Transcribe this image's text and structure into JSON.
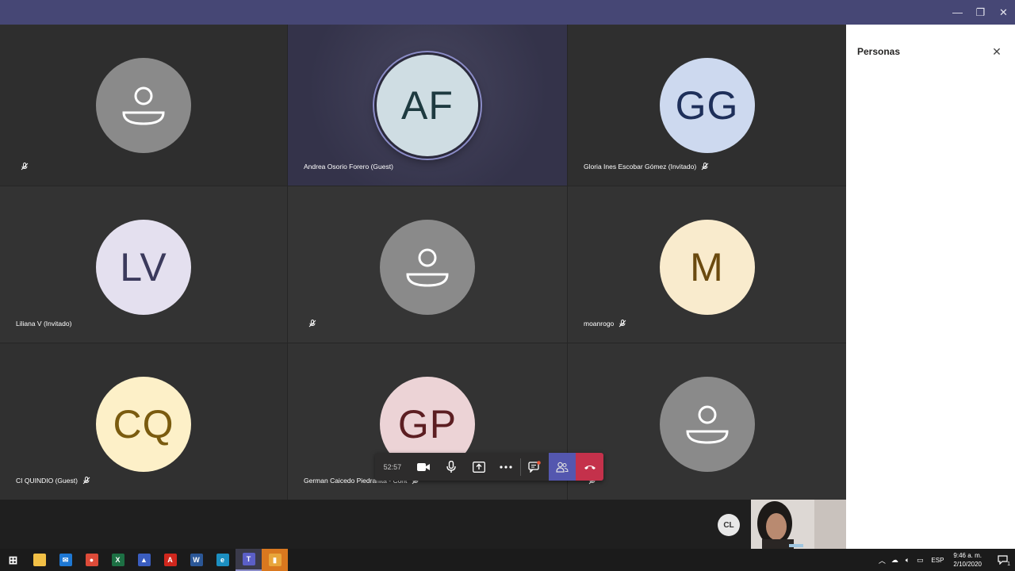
{
  "window": {
    "minimize_label": "—",
    "restore_label": "❐",
    "close_label": "✕"
  },
  "tiles": [
    {
      "kind": "generic",
      "name": "",
      "muted": true
    },
    {
      "kind": "initials",
      "initials": "AF",
      "name": "Andrea Osorio Forero (Guest)",
      "muted": false,
      "speaking": true,
      "bg": "#cfdde3",
      "fg": "#1e3a40"
    },
    {
      "kind": "initials",
      "initials": "GG",
      "name": "Gloria Ines Escobar Gómez (Invitado)",
      "muted": true,
      "bg": "#cdd9ef",
      "fg": "#1e2f5a"
    },
    {
      "kind": "initials",
      "initials": "LV",
      "name": "Liliana V (Invitado)",
      "muted": false,
      "bg": "#e4e0ef",
      "fg": "#3b3a5c"
    },
    {
      "kind": "generic",
      "name": "",
      "muted": true
    },
    {
      "kind": "initials",
      "initials": "M",
      "name": "moanrogo",
      "muted": true,
      "bg": "#f9ebcd",
      "fg": "#6b4a0f"
    },
    {
      "kind": "initials",
      "initials": "CQ",
      "name": "CI QUINDIO (Guest)",
      "muted": true,
      "bg": "#fdf0c8",
      "fg": "#7a5b0f"
    },
    {
      "kind": "initials",
      "initials": "GP",
      "name": "German Caicedo Piedrahita - Cont",
      "muted": true,
      "bg": "#ecd3d6",
      "fg": "#5c1e22"
    },
    {
      "kind": "generic",
      "name": "",
      "muted": true
    }
  ],
  "controls": {
    "timer": "52:57",
    "icons": [
      "video-icon",
      "microphone-icon",
      "share-screen-icon",
      "more-icon",
      "chat-icon",
      "people-icon",
      "hang-up-icon"
    ]
  },
  "panel": {
    "title": "Personas",
    "close_label": "✕"
  },
  "self_view": {
    "initials": "CL"
  },
  "taskbar": {
    "apps": [
      {
        "name": "start",
        "color": "#1b1b1b",
        "glyph": "⊞"
      },
      {
        "name": "file-explorer",
        "color": "#f2c046",
        "glyph": ""
      },
      {
        "name": "mail",
        "color": "#1e78d4",
        "glyph": "✉"
      },
      {
        "name": "chrome",
        "color": "#dd4b39",
        "glyph": "●"
      },
      {
        "name": "excel",
        "color": "#1d7044",
        "glyph": "X"
      },
      {
        "name": "app",
        "color": "#3a5dbf",
        "glyph": "▲"
      },
      {
        "name": "acrobat",
        "color": "#d0271d",
        "glyph": "A"
      },
      {
        "name": "word",
        "color": "#2b5797",
        "glyph": "W"
      },
      {
        "name": "edge",
        "color": "#1c8fc1",
        "glyph": "e"
      },
      {
        "name": "teams",
        "color": "#5b5fc7",
        "glyph": "T"
      },
      {
        "name": "app2",
        "color": "#e8a53a",
        "glyph": "▮"
      }
    ],
    "tray": {
      "language": "ESP",
      "time": "9:46 a. m.",
      "date": "2/10/2020",
      "notifications": "1"
    }
  }
}
